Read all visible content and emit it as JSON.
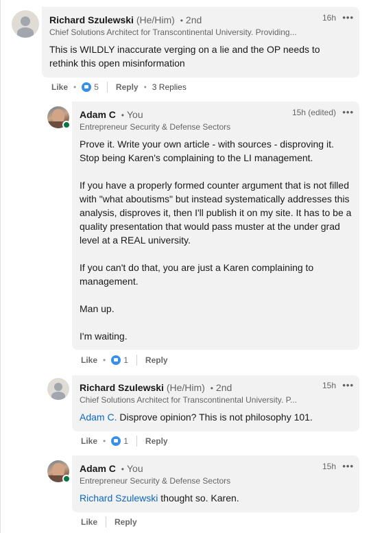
{
  "comments": [
    {
      "name": "Richard Szulewski",
      "pronouns": "(He/Him)",
      "degree": "2nd",
      "headline": "Chief Solutions Architect for Transcontinental University. Providing...",
      "time": "16h",
      "body": [
        "This is WILDLY inaccurate verging on a lie and the OP needs to rethink this open misinformation"
      ],
      "like_label": "Like",
      "reaction_count": "5",
      "reply_label": "Reply",
      "replies_label": "3 Replies"
    },
    {
      "name": "Adam C",
      "you_label": "You",
      "headline": "Entrepreneur Security & Defense Sectors",
      "time": "15h (edited)",
      "body": [
        "Prove it. Write your own article - with sources - disproving it. Stop being Karen's complaining to the LI management.",
        "If you have a properly formed counter argument that is not filled with \"what aboutisms\" but instead systematically addresses this analysis, disproves it, then I'll publish it on my site. It has to be a quality presentation that would pass muster at the under grad level at a REAL university.",
        "If you can't do that, you are just a Karen complaining to management.",
        "Man up.",
        "I'm waiting."
      ],
      "like_label": "Like",
      "reaction_count": "1",
      "reply_label": "Reply"
    },
    {
      "name": "Richard Szulewski",
      "pronouns": "(He/Him)",
      "degree": "2nd",
      "headline": "Chief Solutions Architect for Transcontinental University. P...",
      "time": "15h",
      "mention": "Adam C.",
      "body_rest": " Disprove opinion? This is not philosophy 101.",
      "like_label": "Like",
      "reaction_count": "1",
      "reply_label": "Reply"
    },
    {
      "name": "Adam C",
      "you_label": "You",
      "headline": "Entrepreneur Security & Defense Sectors",
      "time": "15h",
      "mention": "Richard Szulewski",
      "body_rest": " thought so. Karen.",
      "like_label": "Like",
      "reply_label": "Reply"
    }
  ],
  "bullet": "•",
  "more_glyph": "•••"
}
